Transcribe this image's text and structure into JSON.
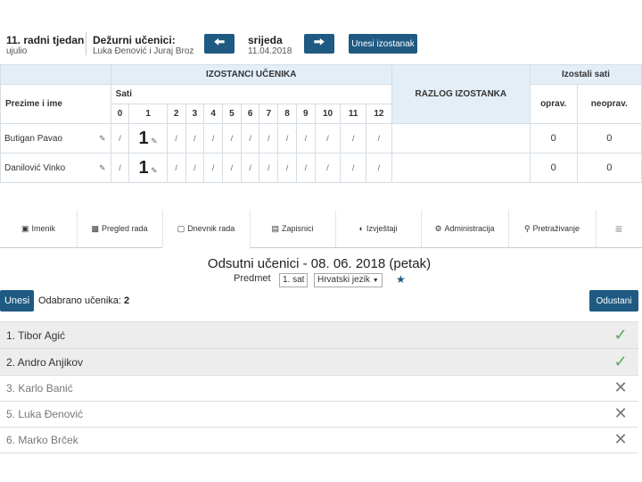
{
  "header": {
    "week": "11. radni tjedan",
    "month": "ujulio",
    "duty_label": "Dežurni učenici:",
    "duty_names": "Luka Đenović i Juraj Broz",
    "day": "srijeda",
    "date": "11.04.2018",
    "prev_icon": "arrow-left-icon",
    "next_icon": "arrow-right-icon",
    "add_absence": "Unesi izostanak"
  },
  "attendance": {
    "main_header": "IZOSTANCI UČENIKA",
    "reason_header": "RAZLOG IZOSTANKA",
    "missed_header": "Izostali sati",
    "name_header": "Prezime i ime",
    "hours_label": "Sati",
    "hours": [
      "0",
      "1",
      "2",
      "3",
      "4",
      "5",
      "6",
      "7",
      "8",
      "9",
      "10",
      "11",
      "12"
    ],
    "excused": "oprav.",
    "unexcused": "neoprav.",
    "students": [
      {
        "name": "Butigan Pavao",
        "mark_one": "1",
        "mark": "/",
        "excused": "0",
        "unexcused": "0"
      },
      {
        "name": "Danilović Vinko",
        "mark_one": "1",
        "mark": "/",
        "excused": "0",
        "unexcused": "0"
      }
    ]
  },
  "tabs": [
    {
      "label": "Imenik",
      "icon": "book-icon"
    },
    {
      "label": "Pregled rada",
      "icon": "briefcase-icon"
    },
    {
      "label": "Dnevnik rada",
      "icon": "journal-icon"
    },
    {
      "label": "Zapisnici",
      "icon": "inbox-icon"
    },
    {
      "label": "Izvještaji",
      "icon": "pie-icon"
    },
    {
      "label": "Administracija",
      "icon": "gear-icon"
    },
    {
      "label": "Pretraživanje",
      "icon": "search-icon"
    },
    {
      "label": "≡",
      "icon": "menu-icon"
    }
  ],
  "absent": {
    "title": "Odsutni učenici - 08. 06. 2018 (petak)",
    "subject_label": "Predmet",
    "hour_select": "1. sat",
    "subject_select": "Hrvatski jezik",
    "star": "★",
    "enter_button": "Unesi",
    "selected_label": "Odabrano učenika:",
    "selected_count": "2",
    "absent_button": "Odustani",
    "check_mark": "✓",
    "cross_mark": "✕",
    "students": [
      {
        "name": "1. Tibor Agić",
        "selected": true
      },
      {
        "name": "2. Andro Anjikov",
        "selected": true
      },
      {
        "name": "3. Karlo Banić",
        "selected": false
      },
      {
        "name": "5. Luka Đenović",
        "selected": false
      },
      {
        "name": "6. Marko Brček",
        "selected": false
      }
    ]
  },
  "colors": {
    "primary": "#1f5a82",
    "header_bg": "#e3eef7",
    "selected_row": "#ededed",
    "check": "#5aa85a"
  }
}
